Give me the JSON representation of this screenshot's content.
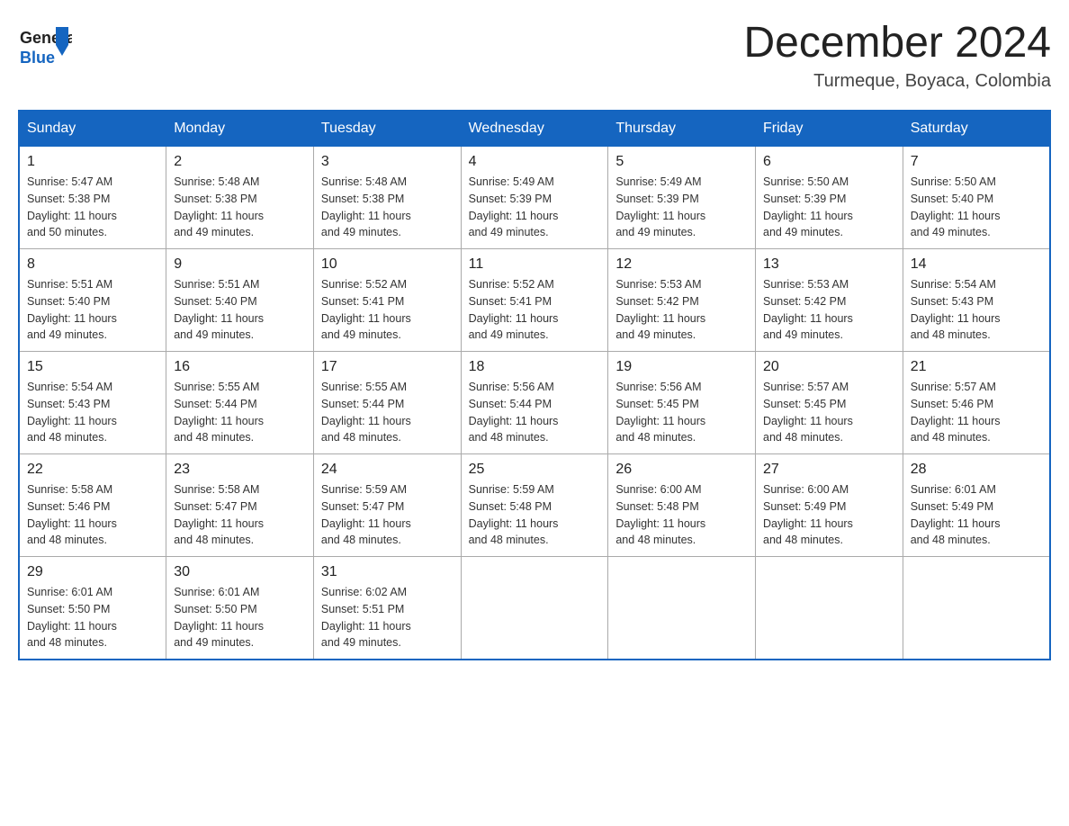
{
  "header": {
    "logo": {
      "general": "General",
      "blue": "Blue"
    },
    "month_title": "December 2024",
    "location": "Turmeque, Boyaca, Colombia"
  },
  "days_of_week": [
    "Sunday",
    "Monday",
    "Tuesday",
    "Wednesday",
    "Thursday",
    "Friday",
    "Saturday"
  ],
  "weeks": [
    [
      {
        "day": "1",
        "sunrise": "5:47 AM",
        "sunset": "5:38 PM",
        "daylight": "11 hours and 50 minutes."
      },
      {
        "day": "2",
        "sunrise": "5:48 AM",
        "sunset": "5:38 PM",
        "daylight": "11 hours and 49 minutes."
      },
      {
        "day": "3",
        "sunrise": "5:48 AM",
        "sunset": "5:38 PM",
        "daylight": "11 hours and 49 minutes."
      },
      {
        "day": "4",
        "sunrise": "5:49 AM",
        "sunset": "5:39 PM",
        "daylight": "11 hours and 49 minutes."
      },
      {
        "day": "5",
        "sunrise": "5:49 AM",
        "sunset": "5:39 PM",
        "daylight": "11 hours and 49 minutes."
      },
      {
        "day": "6",
        "sunrise": "5:50 AM",
        "sunset": "5:39 PM",
        "daylight": "11 hours and 49 minutes."
      },
      {
        "day": "7",
        "sunrise": "5:50 AM",
        "sunset": "5:40 PM",
        "daylight": "11 hours and 49 minutes."
      }
    ],
    [
      {
        "day": "8",
        "sunrise": "5:51 AM",
        "sunset": "5:40 PM",
        "daylight": "11 hours and 49 minutes."
      },
      {
        "day": "9",
        "sunrise": "5:51 AM",
        "sunset": "5:40 PM",
        "daylight": "11 hours and 49 minutes."
      },
      {
        "day": "10",
        "sunrise": "5:52 AM",
        "sunset": "5:41 PM",
        "daylight": "11 hours and 49 minutes."
      },
      {
        "day": "11",
        "sunrise": "5:52 AM",
        "sunset": "5:41 PM",
        "daylight": "11 hours and 49 minutes."
      },
      {
        "day": "12",
        "sunrise": "5:53 AM",
        "sunset": "5:42 PM",
        "daylight": "11 hours and 49 minutes."
      },
      {
        "day": "13",
        "sunrise": "5:53 AM",
        "sunset": "5:42 PM",
        "daylight": "11 hours and 49 minutes."
      },
      {
        "day": "14",
        "sunrise": "5:54 AM",
        "sunset": "5:43 PM",
        "daylight": "11 hours and 48 minutes."
      }
    ],
    [
      {
        "day": "15",
        "sunrise": "5:54 AM",
        "sunset": "5:43 PM",
        "daylight": "11 hours and 48 minutes."
      },
      {
        "day": "16",
        "sunrise": "5:55 AM",
        "sunset": "5:44 PM",
        "daylight": "11 hours and 48 minutes."
      },
      {
        "day": "17",
        "sunrise": "5:55 AM",
        "sunset": "5:44 PM",
        "daylight": "11 hours and 48 minutes."
      },
      {
        "day": "18",
        "sunrise": "5:56 AM",
        "sunset": "5:44 PM",
        "daylight": "11 hours and 48 minutes."
      },
      {
        "day": "19",
        "sunrise": "5:56 AM",
        "sunset": "5:45 PM",
        "daylight": "11 hours and 48 minutes."
      },
      {
        "day": "20",
        "sunrise": "5:57 AM",
        "sunset": "5:45 PM",
        "daylight": "11 hours and 48 minutes."
      },
      {
        "day": "21",
        "sunrise": "5:57 AM",
        "sunset": "5:46 PM",
        "daylight": "11 hours and 48 minutes."
      }
    ],
    [
      {
        "day": "22",
        "sunrise": "5:58 AM",
        "sunset": "5:46 PM",
        "daylight": "11 hours and 48 minutes."
      },
      {
        "day": "23",
        "sunrise": "5:58 AM",
        "sunset": "5:47 PM",
        "daylight": "11 hours and 48 minutes."
      },
      {
        "day": "24",
        "sunrise": "5:59 AM",
        "sunset": "5:47 PM",
        "daylight": "11 hours and 48 minutes."
      },
      {
        "day": "25",
        "sunrise": "5:59 AM",
        "sunset": "5:48 PM",
        "daylight": "11 hours and 48 minutes."
      },
      {
        "day": "26",
        "sunrise": "6:00 AM",
        "sunset": "5:48 PM",
        "daylight": "11 hours and 48 minutes."
      },
      {
        "day": "27",
        "sunrise": "6:00 AM",
        "sunset": "5:49 PM",
        "daylight": "11 hours and 48 minutes."
      },
      {
        "day": "28",
        "sunrise": "6:01 AM",
        "sunset": "5:49 PM",
        "daylight": "11 hours and 48 minutes."
      }
    ],
    [
      {
        "day": "29",
        "sunrise": "6:01 AM",
        "sunset": "5:50 PM",
        "daylight": "11 hours and 48 minutes."
      },
      {
        "day": "30",
        "sunrise": "6:01 AM",
        "sunset": "5:50 PM",
        "daylight": "11 hours and 49 minutes."
      },
      {
        "day": "31",
        "sunrise": "6:02 AM",
        "sunset": "5:51 PM",
        "daylight": "11 hours and 49 minutes."
      },
      null,
      null,
      null,
      null
    ]
  ],
  "labels": {
    "sunrise": "Sunrise:",
    "sunset": "Sunset:",
    "daylight": "Daylight:"
  }
}
